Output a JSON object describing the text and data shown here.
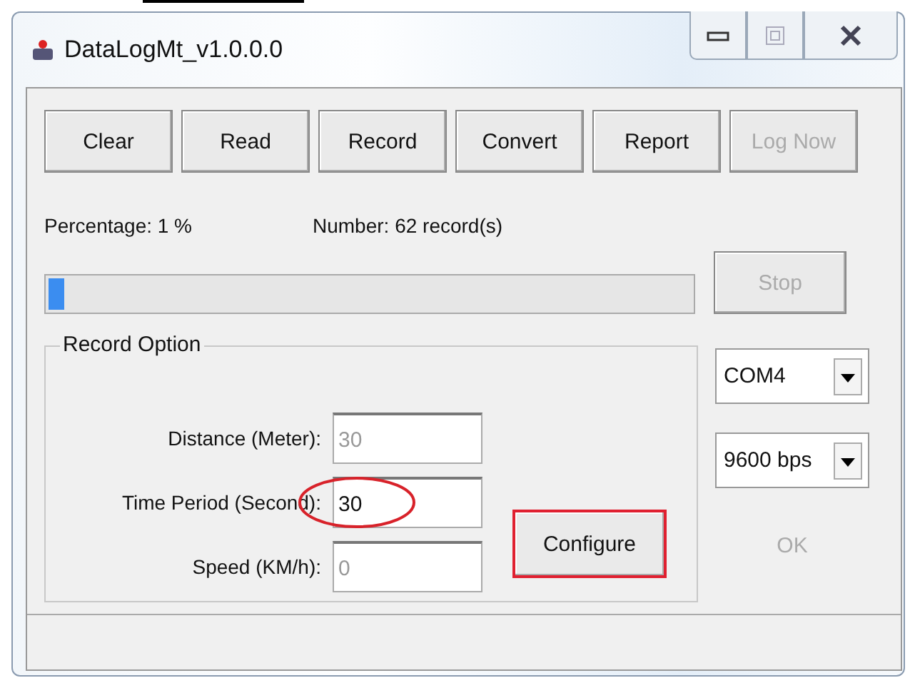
{
  "window": {
    "title": "DataLogMt_v1.0.0.0"
  },
  "toolbar": [
    {
      "label": "Clear",
      "disabled": false
    },
    {
      "label": "Read",
      "disabled": false
    },
    {
      "label": "Record",
      "disabled": false
    },
    {
      "label": "Convert",
      "disabled": false
    },
    {
      "label": "Report",
      "disabled": false
    },
    {
      "label": "Log Now",
      "disabled": true
    }
  ],
  "percentage": "Percentage: 1 %",
  "number": "Number: 62 record(s)",
  "progress": {
    "level": 0.025
  },
  "stop_button": {
    "label": "Stop",
    "disabled": true
  },
  "record_option": {
    "title": "Record Option",
    "fields": [
      {
        "label": "Distance (Meter):",
        "value": "30",
        "disabled": true,
        "circled": false
      },
      {
        "label": "Time Period (Second):",
        "value": "30",
        "disabled": false,
        "circled": true
      },
      {
        "label": "Speed (KM/h):",
        "value": "0",
        "disabled": true,
        "circled": false
      }
    ],
    "configure_button": {
      "label": "Configure",
      "highlighted": true
    }
  },
  "port": {
    "value": "COM4"
  },
  "baud": {
    "value": "9600 bps"
  },
  "ok_button": {
    "label": "OK",
    "disabled": true
  }
}
